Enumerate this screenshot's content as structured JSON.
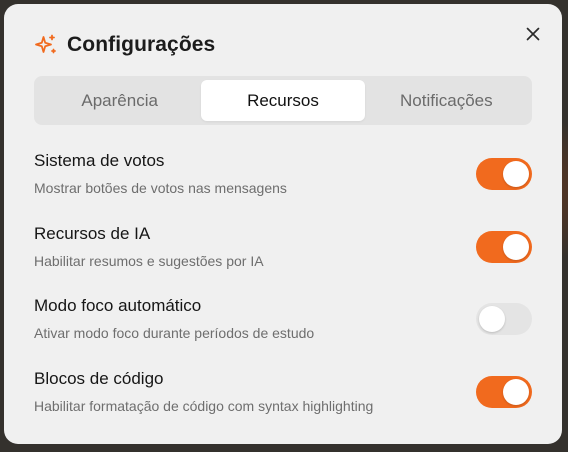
{
  "dialog": {
    "title": "Configurações",
    "icon": "sparkle-icon",
    "close_icon": "close-icon",
    "accent_color": "#f16a1e"
  },
  "tabs": [
    {
      "label": "Aparência",
      "active": false
    },
    {
      "label": "Recursos",
      "active": true
    },
    {
      "label": "Notificações",
      "active": false
    }
  ],
  "settings": [
    {
      "title": "Sistema de votos",
      "description": "Mostrar botões de votos nas mensagens",
      "enabled": true
    },
    {
      "title": "Recursos de IA",
      "description": "Habilitar resumos e sugestões por IA",
      "enabled": true
    },
    {
      "title": "Modo foco automático",
      "description": "Ativar modo foco durante períodos de estudo",
      "enabled": false
    },
    {
      "title": "Blocos de código",
      "description": "Habilitar formatação de código com syntax highlighting",
      "enabled": true
    }
  ]
}
